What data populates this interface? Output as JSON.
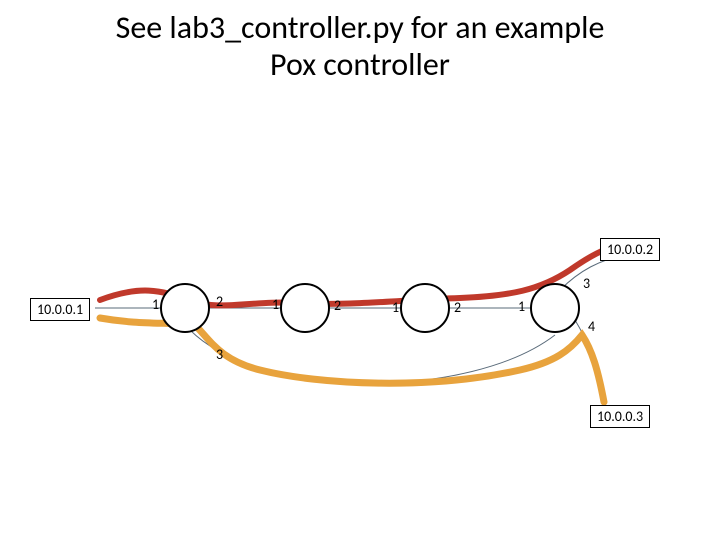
{
  "title_line1": "See lab3_controller.py for an example",
  "title_line2": "Pox controller",
  "hosts": {
    "h1": "10.0.0.1",
    "h2": "10.0.0.2",
    "h3": "10.0.0.3"
  },
  "ports": {
    "s1_p1": "1",
    "s1_p2": "2",
    "s1_p3": "3",
    "s2_p1": "1",
    "s2_p2": "2",
    "s3_p1": "1",
    "s3_p2": "2",
    "s4_p1": "1",
    "s4_p3": "3",
    "s4_p4": "4"
  },
  "colors": {
    "path_red": "#C0392B",
    "path_orange": "#E8A33D",
    "wire": "#5A6B7A"
  }
}
